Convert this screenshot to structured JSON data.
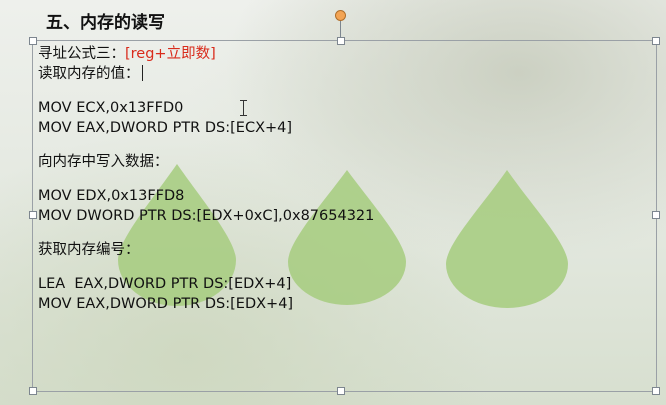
{
  "slide": {
    "title": "五、内存的读写"
  },
  "textbox": {
    "formula_prefix": "寻址公式三：",
    "formula_value": "[reg+立即数]",
    "read_label": "读取内存的值：",
    "read_code": [
      "MOV ECX,0x13FFD0",
      "MOV EAX,DWORD PTR DS:[ECX+4]"
    ],
    "write_label": "向内存中写入数据：",
    "write_code": [
      "MOV EDX,0x13FFD8",
      "MOV DWORD PTR DS:[EDX+0xC],0x87654321"
    ],
    "address_label": "获取内存编号：",
    "address_code": [
      "LEA  EAX,DWORD PTR DS:[EDX+4]",
      "MOV EAX,DWORD PTR DS:[EDX+4]"
    ]
  },
  "colors": {
    "highlight": "#d92b1c",
    "drop": "#a9cd83",
    "rotate_handle": "#f3a454"
  }
}
